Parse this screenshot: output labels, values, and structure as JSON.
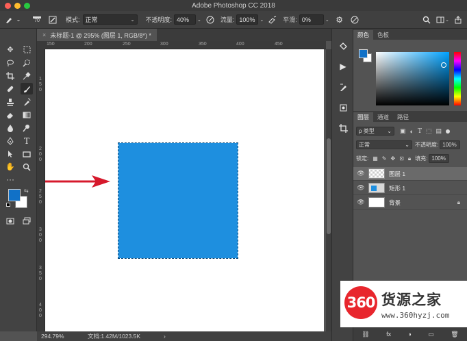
{
  "window": {
    "title": "Adobe Photoshop CC 2018"
  },
  "traffic_colors": {
    "close": "#fd5f57",
    "minimize": "#febc2e",
    "zoom": "#28c840"
  },
  "options": {
    "brush_size": "70",
    "mode_label": "模式:",
    "mode_value": "正常",
    "opacity_label": "不透明度:",
    "opacity_value": "40%",
    "flow_label": "流量:",
    "flow_value": "100%",
    "smoothing_label": "平滑:",
    "smoothing_value": "0%"
  },
  "document": {
    "tab_title": "未标题-1 @ 295% (图层 1, RGB/8*) *",
    "close_glyph": "×",
    "status_zoom": "294.79%",
    "status_doc": "文档:1.42M/1023.5K",
    "status_arrow": "›"
  },
  "ruler": {
    "top": [
      "150",
      "200",
      "250",
      "300",
      "350",
      "400",
      "450"
    ],
    "left": [
      "1",
      "5",
      "0",
      "2",
      "0",
      "0",
      "2",
      "5",
      "0",
      "3",
      "0",
      "0",
      "3",
      "5",
      "0",
      "4",
      "0",
      "0"
    ]
  },
  "canvas": {
    "square_color": "#1e8fdf",
    "arrow_color": "#d6192c"
  },
  "color_panel": {
    "tabs": [
      "颜色",
      "色板"
    ],
    "foreground": "#1171c7",
    "background": "#ffffff"
  },
  "layers_panel": {
    "tabs": [
      "图层",
      "通道",
      "路径"
    ],
    "filter_label": "ρ 类型",
    "blend_mode": "正常",
    "opacity_label": "不透明度:",
    "opacity_value": "100%",
    "lock_label": "锁定:",
    "fill_label": "填充:",
    "fill_value": "100%",
    "layers": [
      {
        "name": "图层 1",
        "selected": true
      },
      {
        "name": "矩形 1",
        "selected": false
      },
      {
        "name": "背景",
        "selected": false,
        "locked": true
      }
    ],
    "bottom_icons": [
      "fx",
      "◑",
      "▭",
      "🗑"
    ]
  },
  "watermark": {
    "logo_text": "360",
    "title": "货源之家",
    "url": "www.360hyzj.com"
  }
}
